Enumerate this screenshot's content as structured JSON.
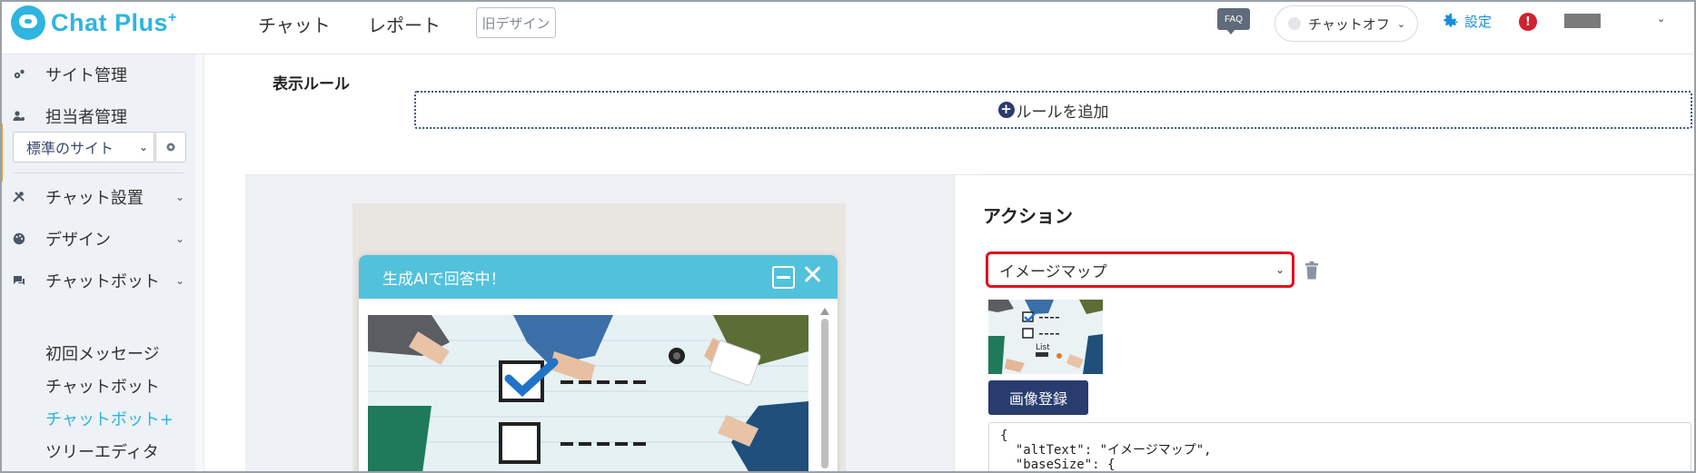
{
  "header": {
    "logo_text": "Chat Plus",
    "logo_sup": "+",
    "nav": [
      "チャット",
      "レポート"
    ],
    "old_design": "旧デザイン",
    "faq": "FAQ",
    "chat_status": "チャットオフ",
    "settings": "設定",
    "alert": "!"
  },
  "sidebar": {
    "site_management": "サイト管理",
    "staff_management": "担当者管理",
    "site_select": "標準のサイト",
    "chat_setup": "チャット設置",
    "design": "デザイン",
    "chatbot": "チャットボット",
    "sub_items": [
      "初回メッセージ",
      "チャットボット",
      "チャットボット+",
      "ツリーエディタ"
    ],
    "active_sub": "チャットボット+"
  },
  "main": {
    "display_rules_title": "表示ルール",
    "add_rule_label": "ルールを追加",
    "preview": {
      "widget_title": "生成AIで回答中！"
    },
    "action": {
      "title": "アクション",
      "selected": "イメージマップ",
      "thumb_label": "List",
      "register_image_button": "画像登録",
      "json_lines": [
        "{",
        "  \"altText\": \"イメージマップ\",",
        "  \"baseSize\": {"
      ]
    }
  },
  "colors": {
    "brand": "#2eb5e0",
    "accent_active": "#2cb4dd",
    "widget_header": "#52c1dc",
    "primary_button": "#283c6e",
    "highlight_border": "#e0101e",
    "alert": "#d0232f"
  }
}
